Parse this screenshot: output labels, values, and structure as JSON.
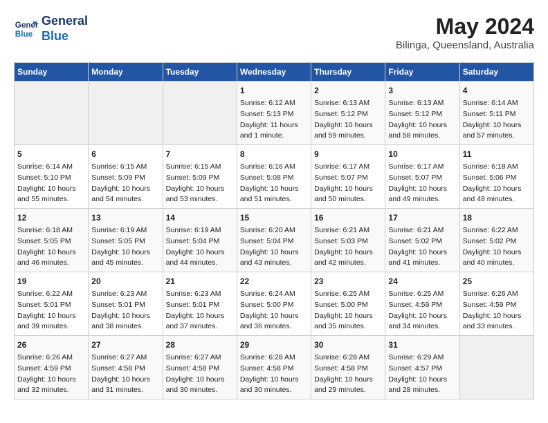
{
  "header": {
    "logo_line1": "General",
    "logo_line2": "Blue",
    "title": "May 2024",
    "subtitle": "Bilinga, Queensland, Australia"
  },
  "calendar": {
    "days_of_week": [
      "Sunday",
      "Monday",
      "Tuesday",
      "Wednesday",
      "Thursday",
      "Friday",
      "Saturday"
    ],
    "weeks": [
      [
        {
          "day": "",
          "content": ""
        },
        {
          "day": "",
          "content": ""
        },
        {
          "day": "",
          "content": ""
        },
        {
          "day": "1",
          "content": "Sunrise: 6:12 AM\nSunset: 5:13 PM\nDaylight: 11 hours\nand 1 minute."
        },
        {
          "day": "2",
          "content": "Sunrise: 6:13 AM\nSunset: 5:12 PM\nDaylight: 10 hours\nand 59 minutes."
        },
        {
          "day": "3",
          "content": "Sunrise: 6:13 AM\nSunset: 5:12 PM\nDaylight: 10 hours\nand 58 minutes."
        },
        {
          "day": "4",
          "content": "Sunrise: 6:14 AM\nSunset: 5:11 PM\nDaylight: 10 hours\nand 57 minutes."
        }
      ],
      [
        {
          "day": "5",
          "content": "Sunrise: 6:14 AM\nSunset: 5:10 PM\nDaylight: 10 hours\nand 55 minutes."
        },
        {
          "day": "6",
          "content": "Sunrise: 6:15 AM\nSunset: 5:09 PM\nDaylight: 10 hours\nand 54 minutes."
        },
        {
          "day": "7",
          "content": "Sunrise: 6:15 AM\nSunset: 5:09 PM\nDaylight: 10 hours\nand 53 minutes."
        },
        {
          "day": "8",
          "content": "Sunrise: 6:16 AM\nSunset: 5:08 PM\nDaylight: 10 hours\nand 51 minutes."
        },
        {
          "day": "9",
          "content": "Sunrise: 6:17 AM\nSunset: 5:07 PM\nDaylight: 10 hours\nand 50 minutes."
        },
        {
          "day": "10",
          "content": "Sunrise: 6:17 AM\nSunset: 5:07 PM\nDaylight: 10 hours\nand 49 minutes."
        },
        {
          "day": "11",
          "content": "Sunrise: 6:18 AM\nSunset: 5:06 PM\nDaylight: 10 hours\nand 48 minutes."
        }
      ],
      [
        {
          "day": "12",
          "content": "Sunrise: 6:18 AM\nSunset: 5:05 PM\nDaylight: 10 hours\nand 46 minutes."
        },
        {
          "day": "13",
          "content": "Sunrise: 6:19 AM\nSunset: 5:05 PM\nDaylight: 10 hours\nand 45 minutes."
        },
        {
          "day": "14",
          "content": "Sunrise: 6:19 AM\nSunset: 5:04 PM\nDaylight: 10 hours\nand 44 minutes."
        },
        {
          "day": "15",
          "content": "Sunrise: 6:20 AM\nSunset: 5:04 PM\nDaylight: 10 hours\nand 43 minutes."
        },
        {
          "day": "16",
          "content": "Sunrise: 6:21 AM\nSunset: 5:03 PM\nDaylight: 10 hours\nand 42 minutes."
        },
        {
          "day": "17",
          "content": "Sunrise: 6:21 AM\nSunset: 5:02 PM\nDaylight: 10 hours\nand 41 minutes."
        },
        {
          "day": "18",
          "content": "Sunrise: 6:22 AM\nSunset: 5:02 PM\nDaylight: 10 hours\nand 40 minutes."
        }
      ],
      [
        {
          "day": "19",
          "content": "Sunrise: 6:22 AM\nSunset: 5:01 PM\nDaylight: 10 hours\nand 39 minutes."
        },
        {
          "day": "20",
          "content": "Sunrise: 6:23 AM\nSunset: 5:01 PM\nDaylight: 10 hours\nand 38 minutes."
        },
        {
          "day": "21",
          "content": "Sunrise: 6:23 AM\nSunset: 5:01 PM\nDaylight: 10 hours\nand 37 minutes."
        },
        {
          "day": "22",
          "content": "Sunrise: 6:24 AM\nSunset: 5:00 PM\nDaylight: 10 hours\nand 36 minutes."
        },
        {
          "day": "23",
          "content": "Sunrise: 6:25 AM\nSunset: 5:00 PM\nDaylight: 10 hours\nand 35 minutes."
        },
        {
          "day": "24",
          "content": "Sunrise: 6:25 AM\nSunset: 4:59 PM\nDaylight: 10 hours\nand 34 minutes."
        },
        {
          "day": "25",
          "content": "Sunrise: 6:26 AM\nSunset: 4:59 PM\nDaylight: 10 hours\nand 33 minutes."
        }
      ],
      [
        {
          "day": "26",
          "content": "Sunrise: 6:26 AM\nSunset: 4:59 PM\nDaylight: 10 hours\nand 32 minutes."
        },
        {
          "day": "27",
          "content": "Sunrise: 6:27 AM\nSunset: 4:58 PM\nDaylight: 10 hours\nand 31 minutes."
        },
        {
          "day": "28",
          "content": "Sunrise: 6:27 AM\nSunset: 4:58 PM\nDaylight: 10 hours\nand 30 minutes."
        },
        {
          "day": "29",
          "content": "Sunrise: 6:28 AM\nSunset: 4:58 PM\nDaylight: 10 hours\nand 30 minutes."
        },
        {
          "day": "30",
          "content": "Sunrise: 6:28 AM\nSunset: 4:58 PM\nDaylight: 10 hours\nand 29 minutes."
        },
        {
          "day": "31",
          "content": "Sunrise: 6:29 AM\nSunset: 4:57 PM\nDaylight: 10 hours\nand 28 minutes."
        },
        {
          "day": "",
          "content": ""
        }
      ]
    ]
  }
}
